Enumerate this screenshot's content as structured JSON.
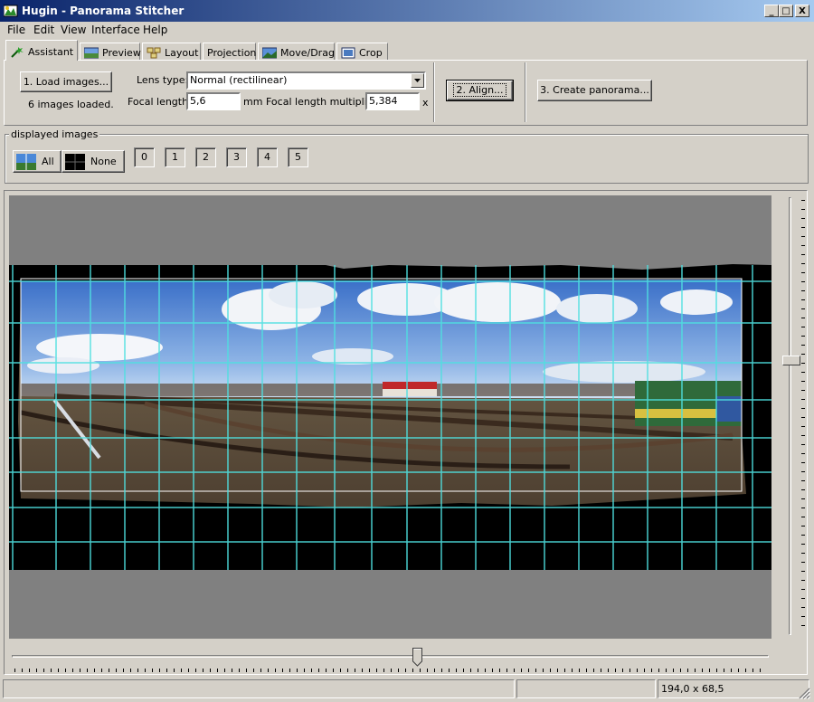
{
  "window": {
    "title": "Hugin - Panorama Stitcher",
    "controls": [
      "_",
      "□",
      "X"
    ]
  },
  "menu": [
    "File",
    "Edit",
    "View",
    "Interface",
    "Help"
  ],
  "tabs": [
    {
      "label": "Assistant",
      "icon": "wand-icon",
      "active": true
    },
    {
      "label": "Preview",
      "icon": "preview-icon"
    },
    {
      "label": "Layout",
      "icon": "layout-icon"
    },
    {
      "label": "Projection",
      "icon": ""
    },
    {
      "label": "Move/Drag",
      "icon": "move-drag-icon"
    },
    {
      "label": "Crop",
      "icon": "crop-icon"
    }
  ],
  "assistant": {
    "load_button": "1. Load images...",
    "images_loaded": "6 images loaded.",
    "lens_type_label": "Lens type:",
    "lens_type_value": "Normal (rectilinear)",
    "focal_length_label": "Focal length:",
    "focal_length_value": "5,6",
    "focal_length_unit": "mm",
    "multiplier_label": "Focal length multiplier:",
    "multiplier_value": "5,384",
    "multiplier_unit": "x",
    "align_button": "2. Align...",
    "create_button": "3. Create panorama..."
  },
  "displayed_images": {
    "label": "displayed images",
    "all_button": "All",
    "none_button": "None",
    "images": [
      "0",
      "1",
      "2",
      "3",
      "4",
      "5"
    ]
  },
  "status": {
    "field1": "",
    "field2": "",
    "field3": "194,0 x 68,5"
  },
  "colors": {
    "titlebar_start": "#0a246a",
    "titlebar_end": "#a6caf0",
    "face": "#d4d0c8",
    "grid_line": "#4fe0e0",
    "preview_bg": "#808080"
  }
}
